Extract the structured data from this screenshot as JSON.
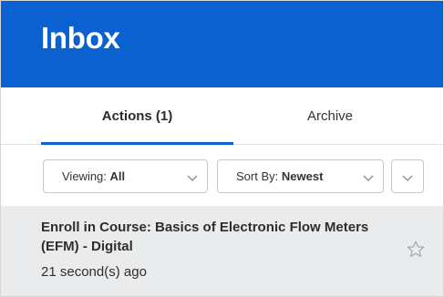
{
  "header": {
    "title": "Inbox",
    "color": "#0b61cf"
  },
  "tabs": [
    {
      "label": "Actions (1)",
      "active": true
    },
    {
      "label": "Archive",
      "active": false
    }
  ],
  "filters": {
    "viewing": {
      "label": "Viewing:",
      "value": "All"
    },
    "sort": {
      "label": "Sort By:",
      "value": "Newest"
    },
    "expand_icon": "chevron-down-icon"
  },
  "items": [
    {
      "title": "Enroll in Course: Basics of Electronic Flow Meters (EFM) - Digital",
      "time": "21 second(s) ago",
      "starred": false
    }
  ]
}
